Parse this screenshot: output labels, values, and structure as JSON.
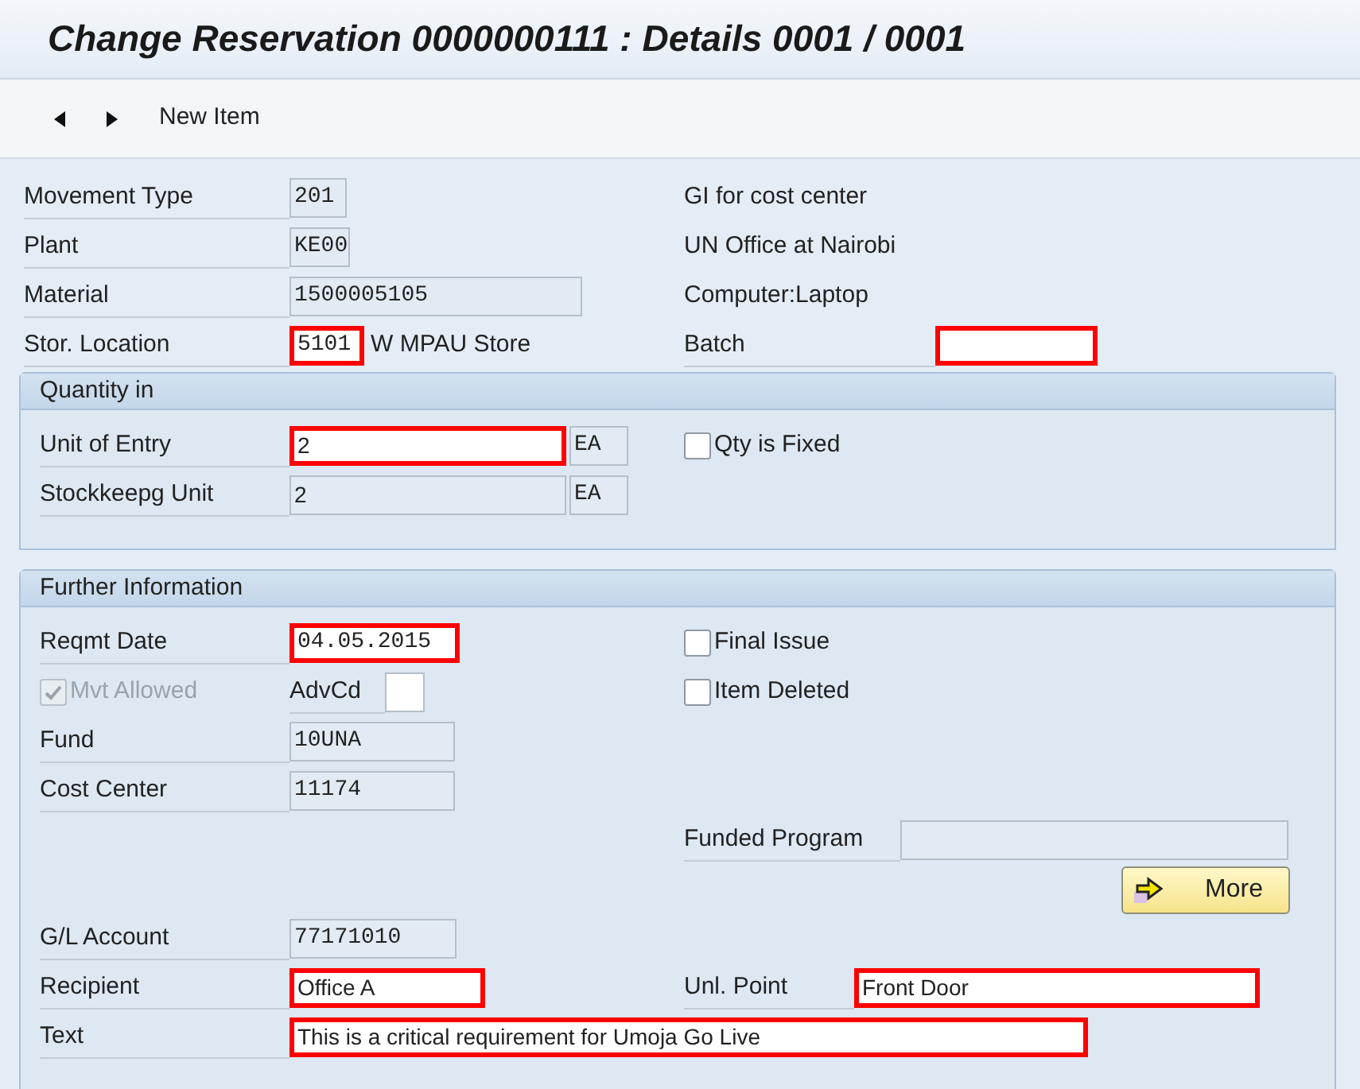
{
  "window": {
    "title": "Change Reservation 0000000111 : Details 0001 / 0001"
  },
  "toolbar": {
    "item_button": "New Item"
  },
  "header": {
    "rows": [
      {
        "left": {
          "kind": "field_row",
          "label": "Movement Type",
          "fields": [
            {
              "value": "201",
              "editable": false,
              "highlighted": false,
              "kind": "char"
            }
          ]
        },
        "right": {
          "kind": "note",
          "text": "GI for cost center"
        }
      },
      {
        "left": {
          "kind": "field_row",
          "label": "Plant",
          "fields": [
            {
              "value": "KE00",
              "editable": false,
              "highlighted": false,
              "kind": "char"
            }
          ]
        },
        "right": {
          "kind": "note",
          "text": "UN Office at Nairobi"
        }
      },
      {
        "left": {
          "kind": "field_row",
          "label": "Material",
          "fields": [
            {
              "value": "1500005105",
              "editable": false,
              "highlighted": false,
              "kind": "char"
            }
          ]
        },
        "right": {
          "kind": "note",
          "text": "Computer:Laptop"
        }
      },
      {
        "left": {
          "kind": "field_row",
          "label": "Stor. Location",
          "fields": [
            {
              "value": "5101",
              "editable": true,
              "highlighted": true,
              "kind": "char"
            }
          ],
          "description": "W MPAU Store"
        },
        "right": {
          "kind": "field_row",
          "label": "Batch",
          "fields": [
            {
              "editable": true,
              "highlighted": true
            }
          ]
        }
      }
    ]
  },
  "groups": [
    {
      "title": "Quantity in",
      "rows": [
        {
          "left": {
            "kind": "field_row",
            "label": "Unit of Entry",
            "fields": [
              {
                "value": "2",
                "editable": true,
                "highlighted": true,
                "kind": "text"
              },
              {
                "value": "EA",
                "editable": false,
                "highlighted": false,
                "kind": "char"
              }
            ]
          },
          "right": {
            "kind": "checkbox",
            "label": "Qty is Fixed",
            "checked": false,
            "disabled": false
          }
        },
        {
          "left": {
            "kind": "field_row",
            "label": "Stockkeepg Unit",
            "fields": [
              {
                "value": "2",
                "editable": false,
                "highlighted": false,
                "kind": "text"
              },
              {
                "value": "EA",
                "editable": false,
                "highlighted": false,
                "kind": "char"
              }
            ]
          }
        }
      ]
    },
    {
      "title": "Further Information",
      "rows": [
        {
          "left": {
            "kind": "field_row",
            "label": "Reqmt Date",
            "fields": [
              {
                "value": "04.05.2015",
                "editable": true,
                "highlighted": true,
                "kind": "char"
              }
            ]
          },
          "right": {
            "kind": "checkbox",
            "label": "Final Issue",
            "checked": false,
            "disabled": false
          }
        },
        {
          "left": {
            "kind": "checkbox_field",
            "label": "Mvt Allowed",
            "checked": true,
            "disabled": true,
            "field_label": "AdvCd",
            "fields": [
              {
                "editable": true,
                "highlighted": false
              }
            ]
          },
          "right": {
            "kind": "checkbox",
            "label": "Item Deleted",
            "checked": false,
            "disabled": false
          }
        },
        {
          "left": {
            "kind": "field_row",
            "label": "Fund",
            "fields": [
              {
                "value": "10UNA",
                "editable": false,
                "highlighted": false,
                "kind": "char"
              }
            ]
          }
        },
        {
          "left": {
            "kind": "field_row",
            "label": "Cost Center",
            "fields": [
              {
                "value": "11174",
                "editable": false,
                "highlighted": false,
                "kind": "char"
              }
            ]
          }
        },
        {
          "right": {
            "kind": "field_row",
            "label": "Funded Program",
            "fields": [
              {
                "editable": false,
                "highlighted": false
              }
            ]
          }
        },
        {
          "right": {
            "kind": "button",
            "label": "More"
          }
        },
        {
          "left": {
            "kind": "field_row",
            "label": "G/L Account",
            "fields": [
              {
                "value": "77171010",
                "editable": false,
                "highlighted": false,
                "kind": "char"
              }
            ]
          }
        },
        {
          "left": {
            "kind": "field_row",
            "label": "Recipient",
            "fields": [
              {
                "value": "Office A",
                "editable": true,
                "highlighted": true,
                "kind": "text"
              }
            ]
          },
          "right": {
            "kind": "field_row",
            "label": "Unl. Point",
            "fields": [
              {
                "value": "Front Door",
                "editable": true,
                "highlighted": true,
                "kind": "text"
              }
            ]
          }
        },
        {
          "left": {
            "kind": "field_row",
            "label": "Text",
            "fields": [
              {
                "value": "This is a critical requirement for Umoja Go Live",
                "editable": true,
                "highlighted": true,
                "kind": "text"
              }
            ]
          }
        }
      ]
    }
  ]
}
